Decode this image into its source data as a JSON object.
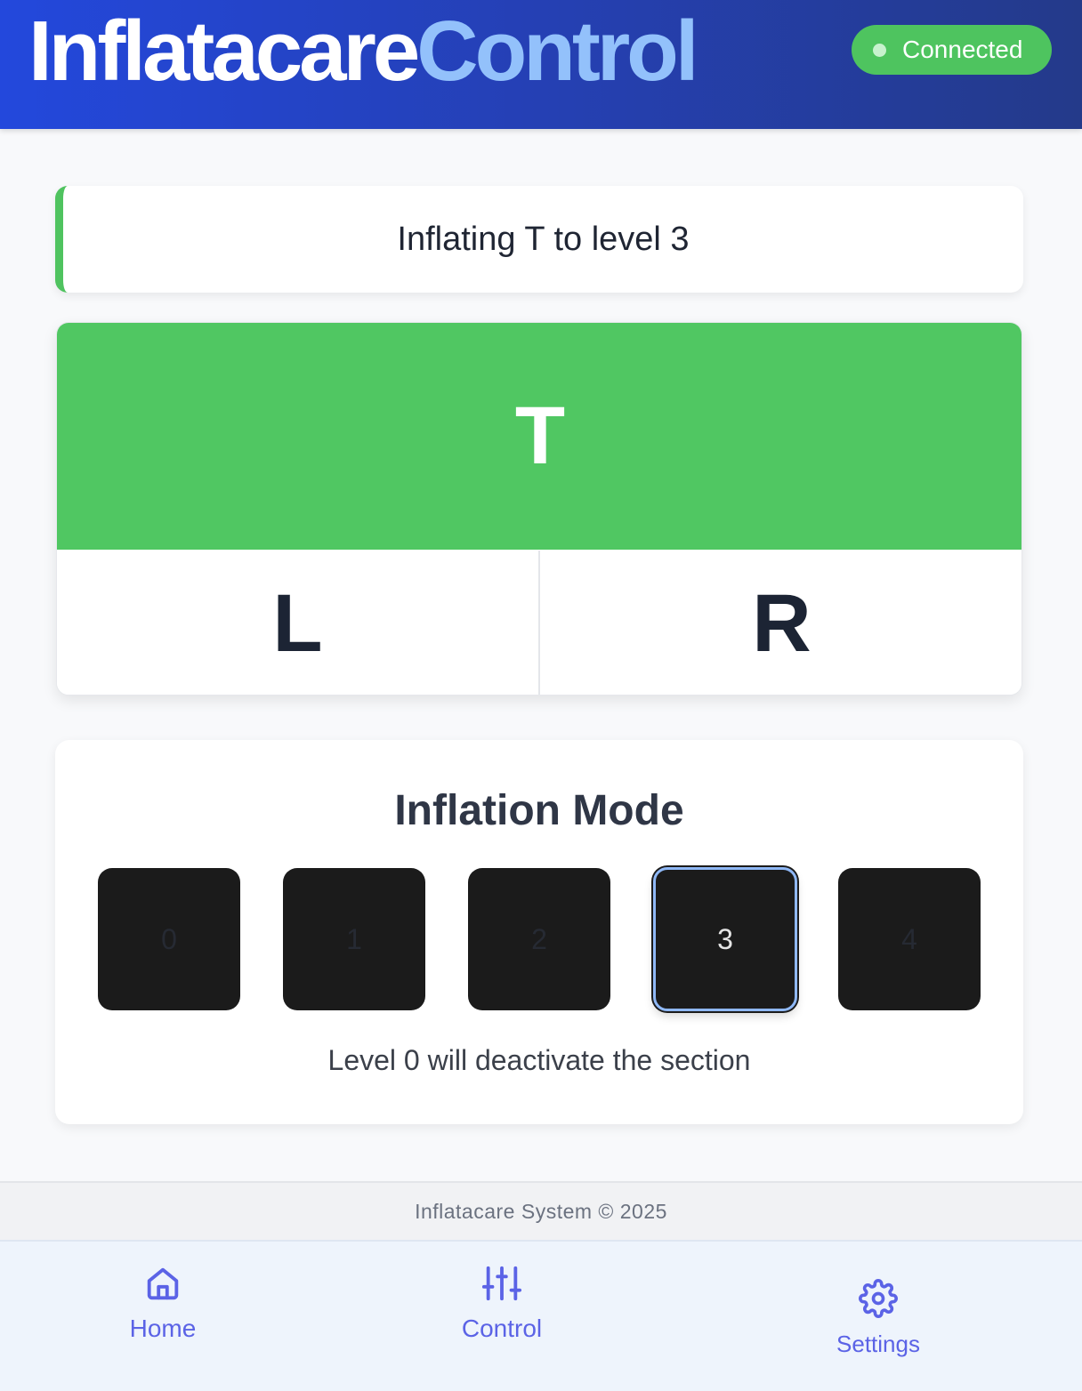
{
  "header": {
    "title_part1": "Inflatacare",
    "title_part2": "Control",
    "status": "Connected",
    "colors": {
      "title_accent": "#93c1fb",
      "status_bg": "#4ec45f"
    }
  },
  "banner": {
    "message": "Inflating T to level 3",
    "accent_color": "#4fc35f"
  },
  "sections": {
    "top": {
      "label": "T",
      "active": true,
      "active_color": "#50c762"
    },
    "left": {
      "label": "L",
      "active": false
    },
    "right": {
      "label": "R",
      "active": false
    }
  },
  "inflation_mode": {
    "title": "Inflation Mode",
    "levels": [
      "0",
      "1",
      "2",
      "3",
      "4"
    ],
    "selected": "3",
    "hint": "Level 0 will deactivate the section"
  },
  "footer": {
    "text": "Inflatacare System © 2025"
  },
  "nav": {
    "items": [
      {
        "label": "Home",
        "icon": "home-icon"
      },
      {
        "label": "Control",
        "icon": "sliders-icon"
      },
      {
        "label": "Settings",
        "icon": "gear-icon"
      }
    ]
  }
}
